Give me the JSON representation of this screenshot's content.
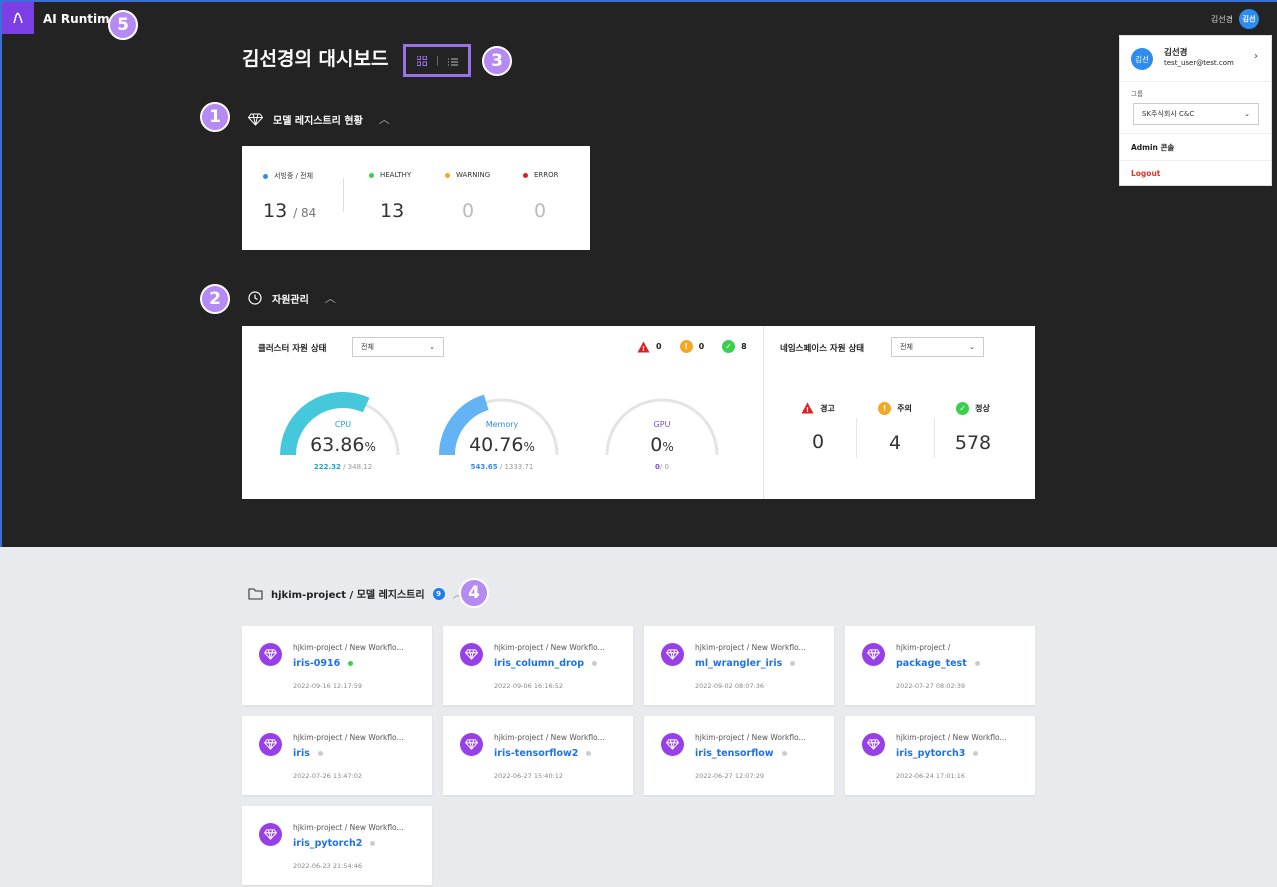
{
  "app": {
    "title": "AI Runtime"
  },
  "markers": [
    "1",
    "2",
    "3",
    "4",
    "5"
  ],
  "header": {
    "user_short": "김선경",
    "avatar": "김선"
  },
  "dashboard": {
    "title": "김선경의 대시보드"
  },
  "user_menu": {
    "avatar": "김선",
    "name": "김선경",
    "email": "test_user@test.com",
    "group_label": "그룹",
    "group_value": "SK주식회사 C&C",
    "admin_label": "Admin 콘솔",
    "logout_label": "Logout"
  },
  "model_registry": {
    "title": "모델 레지스트리 현황",
    "serving_label": "서빙중 / 전체",
    "serving_value": "13",
    "total_value": "/ 84",
    "healthy_label": "HEALTHY",
    "healthy_value": "13",
    "warning_label": "WARNING",
    "warning_value": "0",
    "error_label": "ERROR",
    "error_value": "0"
  },
  "resources": {
    "title": "자원관리",
    "cluster_title": "클러스터 자원 상태",
    "cluster_select": "전체",
    "alert_red": "0",
    "alert_orange": "0",
    "alert_green": "8",
    "cpu": {
      "label": "CPU",
      "percent": "63.86",
      "unit": "%",
      "used": "222.32",
      "total": "/ 348.12",
      "fraction": 0.6386
    },
    "memory": {
      "label": "Memory",
      "percent": "40.76",
      "unit": "%",
      "used": "543.65",
      "total": "/ 1333.71",
      "fraction": 0.4076
    },
    "gpu": {
      "label": "GPU",
      "percent": "0",
      "unit": "%",
      "used": "0",
      "total": "/ 0",
      "fraction": 0
    },
    "ns_title": "네임스페이스 자원 상태",
    "ns_select": "전체",
    "ns_warning_label": "경고",
    "ns_warning_value": "0",
    "ns_caution_label": "주의",
    "ns_caution_value": "4",
    "ns_normal_label": "정상",
    "ns_normal_value": "578"
  },
  "project": {
    "title": "hjkim-project / 모델 레지스트리",
    "count": "9",
    "models": [
      {
        "path": "hjkim-project / New Workflo...",
        "name": "iris-0916",
        "time": "2022-09-16 12:17:59",
        "status": "#3ccf4e"
      },
      {
        "path": "hjkim-project / New Workflo...",
        "name": "iris_column_drop",
        "time": "2022-09-06 16:16:52",
        "status": "#cccccc"
      },
      {
        "path": "hjkim-project / New Workflo...",
        "name": "ml_wrangler_iris",
        "time": "2022-09-02 08:07:36",
        "status": "#cccccc"
      },
      {
        "path": "hjkim-project /",
        "name": "package_test",
        "time": "2022-07-27 08:02:39",
        "status": "#cccccc"
      },
      {
        "path": "hjkim-project / New Workflo...",
        "name": "iris",
        "time": "2022-07-26 13:47:02",
        "status": "#cccccc"
      },
      {
        "path": "hjkim-project / New Workflo...",
        "name": "iris-tensorflow2",
        "time": "2022-06-27 15:40:12",
        "status": "#cccccc"
      },
      {
        "path": "hjkim-project / New Workflo...",
        "name": "iris_tensorflow",
        "time": "2022-06-27 12:07:29",
        "status": "#cccccc"
      },
      {
        "path": "hjkim-project / New Workflo...",
        "name": "iris_pytorch3",
        "time": "2022-06-24 17:01:16",
        "status": "#cccccc"
      },
      {
        "path": "hjkim-project / New Workflo...",
        "name": "iris_pytorch2",
        "time": "2022-06-23 21:54:46",
        "status": "#cccccc"
      }
    ]
  }
}
